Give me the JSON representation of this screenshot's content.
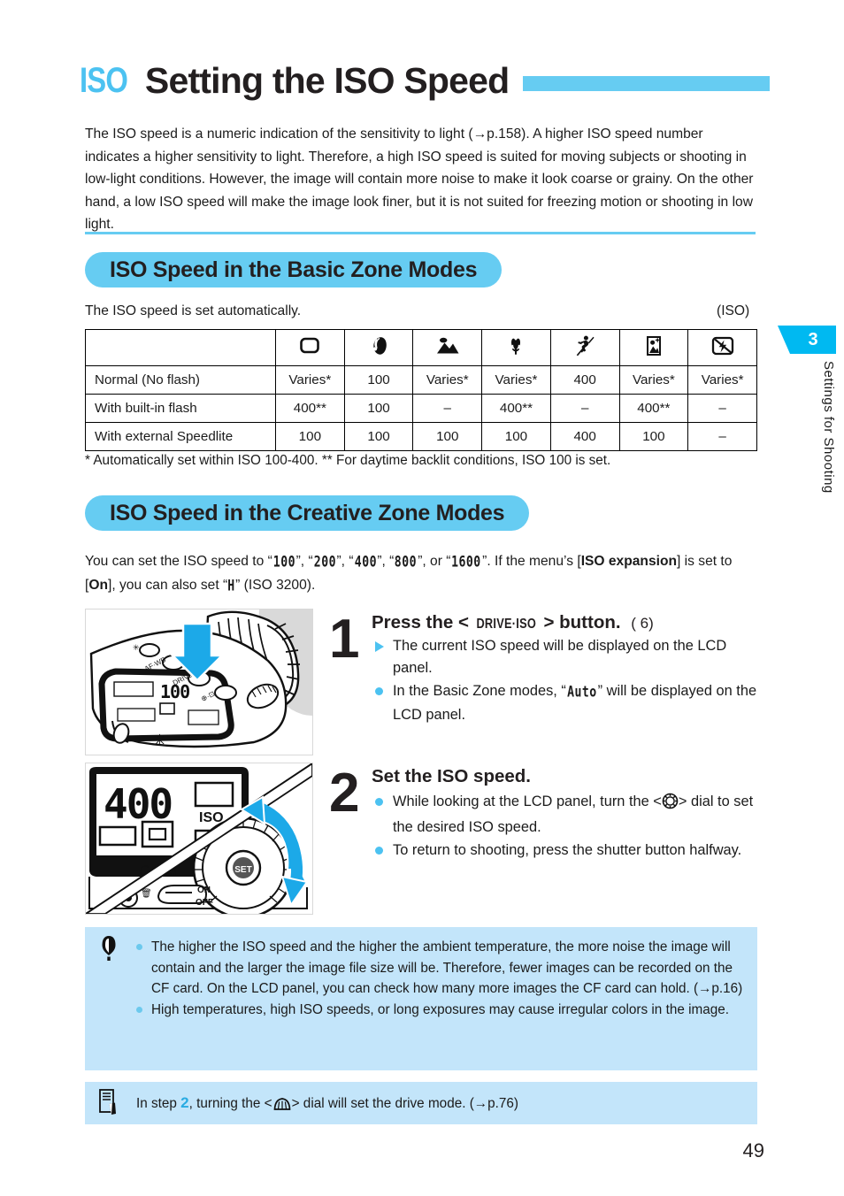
{
  "title": {
    "icon_label": "ISO",
    "text": "Setting the ISO Speed"
  },
  "intro": "The ISO speed is a numeric indication of the sensitivity to light (→p.158). A higher ISO speed number indicates a higher sensitivity to light. Therefore, a high ISO speed is suited for moving subjects or shooting in low-light conditions. However, the image will contain more noise to make it look coarse or grainy. On the other hand, a low ISO speed will make the image look finer, but it is not suited for freezing motion or shooting in low light.",
  "section_basic": {
    "banner": "ISO Speed in the Basic Zone Modes",
    "lead": "The ISO speed is set automatically.",
    "lead_right": "(ISO)",
    "footnote": "* Automatically set within ISO 100-400. ** For daytime backlit conditions, ISO 100 is set."
  },
  "table": {
    "column_icons": [
      "full-auto-icon",
      "portrait-icon",
      "landscape-icon",
      "close-up-icon",
      "sports-icon",
      "night-portrait-icon",
      "flash-off-icon"
    ],
    "rows": [
      {
        "label": "Normal (No flash)",
        "values": [
          "Varies*",
          "100",
          "Varies*",
          "Varies*",
          "400",
          "Varies*",
          "Varies*"
        ]
      },
      {
        "label": "With built-in flash",
        "values": [
          "400**",
          "100",
          "–",
          "400**",
          "–",
          "400**",
          "–"
        ]
      },
      {
        "label": "With external Speedlite",
        "values": [
          "100",
          "100",
          "100",
          "100",
          "400",
          "100",
          "–"
        ]
      }
    ]
  },
  "section_creative": {
    "banner": "ISO Speed in the Creative Zone Modes",
    "para_1": "You can set the ISO speed to “",
    "lcd_100": "100",
    "para_2": "”, “",
    "lcd_200": "200",
    "para_3": "”, “",
    "lcd_400": "400",
    "para_4": "”, “",
    "lcd_800": "800",
    "para_5": "”, or “",
    "lcd_1600": "1600",
    "para_6": "”. If the menu’s [",
    "bold_iso_expansion": "ISO expansion",
    "para_7": "] is set to [",
    "bold_on": "On",
    "para_8": "], you can also set “",
    "lcd_h": "H",
    "para_9": "” (ISO 3200)."
  },
  "steps": [
    {
      "number": "1",
      "heading_pre": "Press the <",
      "heading_button": "DRIVE·ISO",
      "heading_post": "> button.",
      "heading_timer": "( 6)",
      "figure_caption": "camera-top-drive-iso-button",
      "bullets": [
        {
          "marker": "triangle",
          "text": "The current ISO speed will be displayed on the LCD panel."
        },
        {
          "marker": "dot",
          "text_pre": "In the Basic Zone modes, “",
          "lcd": "Auto",
          "text_post": "” will be displayed on the LCD panel."
        }
      ]
    },
    {
      "number": "2",
      "heading": "Set the ISO speed.",
      "figure_caption": "lcd-panel-and-quick-control-dial",
      "lcd_value": "400",
      "lcd_label": "ISO",
      "dial_set_label": "SET",
      "power_on": "ON",
      "power_off": "OFF",
      "bullets": [
        {
          "marker": "dot",
          "text_pre": "While looking at the LCD panel, turn the <",
          "icon": "quick-control-dial-icon",
          "text_post": "> dial to set the desired ISO speed."
        },
        {
          "marker": "dot",
          "text": "To return to shooting, press the shutter button halfway."
        }
      ]
    }
  ],
  "caution_box": {
    "icon": "caution-icon",
    "items": [
      "The higher the ISO speed and the higher the ambient temperature, the more noise the image will contain and the larger the image file size will be. Therefore, fewer images can be recorded on the CF card. On the LCD panel, you can check how many more images the CF card can hold. (→p.16)",
      "High temperatures, high ISO speeds, or long exposures may cause irregular colors in the image."
    ]
  },
  "note_box": {
    "icon": "note-pencil-icon",
    "text_pre": "In step ",
    "step_ref": "2",
    "text_mid": ", turning the <",
    "dial_icon": "main-dial-icon",
    "text_post": "> dial will set the drive mode. (→p.76)"
  },
  "side_tab": {
    "number": "3",
    "label": "Settings for Shooting"
  },
  "page_number": "49",
  "colors": {
    "accent_cyan": "#66CCF2",
    "tab_cyan": "#00B9F1",
    "note_bg": "#C3E5FA",
    "text": "#1b1b1b"
  }
}
